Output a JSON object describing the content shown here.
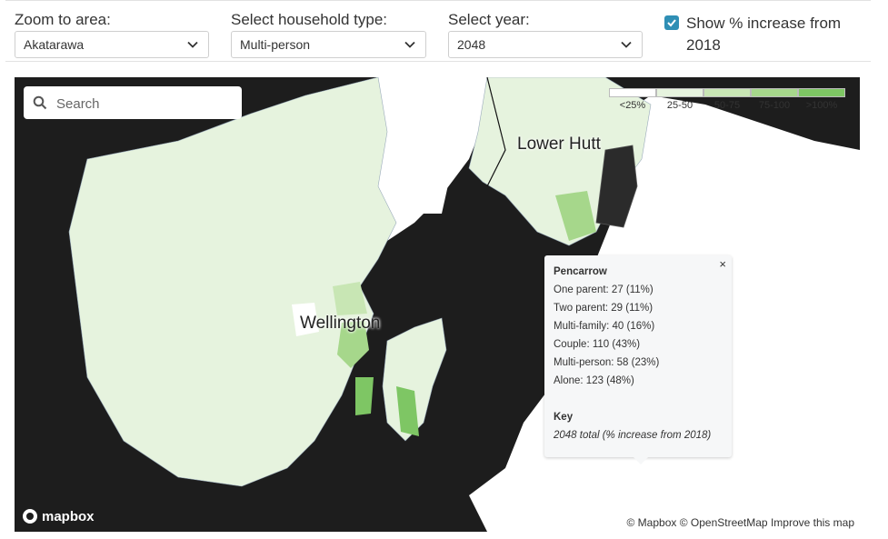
{
  "controls": {
    "area_label": "Zoom to area:",
    "area_value": "Akatarawa",
    "household_label": "Select household type:",
    "household_value": "Multi-person",
    "year_label": "Select year:",
    "year_value": "2048",
    "show_increase_label": "Show % increase from 2018",
    "show_increase_checked": true,
    "checkbox_color": "#2f8fb5"
  },
  "map": {
    "search_placeholder": "Search",
    "city_labels": [
      "Lower Hutt",
      "Wellington"
    ],
    "legend": [
      {
        "label": "<25%",
        "color": "#ffffff"
      },
      {
        "label": "25-50",
        "color": "#e6f3de"
      },
      {
        "label": "50-75",
        "color": "#c8e6b4"
      },
      {
        "label": "75-100",
        "color": "#a6d78b"
      },
      {
        "label": ">100%",
        "color": "#7ec664"
      }
    ],
    "popup": {
      "close": "×",
      "title": "Pencarrow",
      "lines": [
        "One parent: 27 (11%)",
        "Two parent: 29 (11%)",
        "Multi-family: 40 (16%)",
        "Couple: 110 (43%)",
        "Multi-person: 58 (23%)",
        "Alone: 123 (48%)"
      ],
      "key_title": "Key",
      "key_text": "2048 total (% increase from 2018)"
    },
    "logo_text": "mapbox",
    "attribution": {
      "mapbox": "© Mapbox",
      "osm": "© OpenStreetMap",
      "improve": "Improve this map"
    },
    "colors": {
      "water": "#1d1d1d",
      "land": "#e6f3de",
      "outside": "#ffffff",
      "highlight": "#7ec664",
      "selected": "#2b2b2b"
    }
  }
}
